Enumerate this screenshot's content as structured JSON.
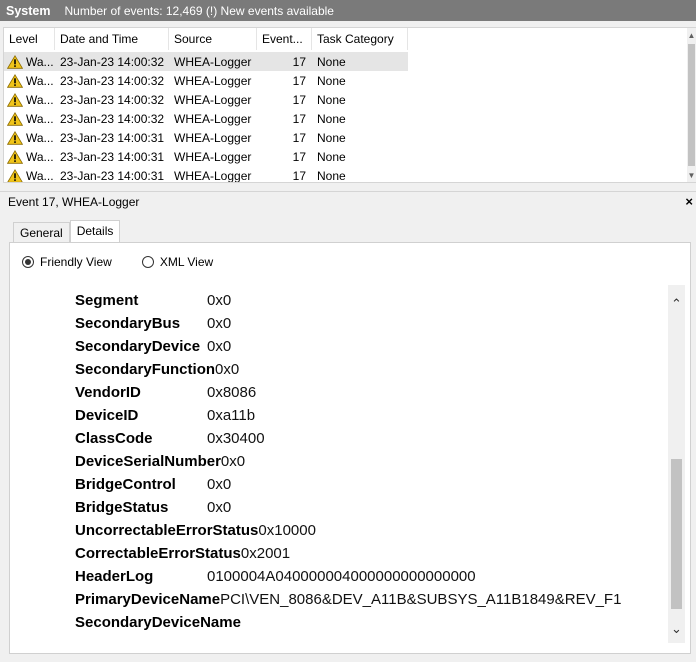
{
  "header": {
    "title": "System",
    "info": "Number of events: 12,469 (!) New events available"
  },
  "events": {
    "columns": [
      "Level",
      "Date and Time",
      "Source",
      "Event...",
      "Task Category"
    ],
    "rows": [
      {
        "level": "Wa...",
        "date": "23-Jan-23 14:00:32",
        "source": "WHEA-Logger",
        "id": "17",
        "task": "None"
      },
      {
        "level": "Wa...",
        "date": "23-Jan-23 14:00:32",
        "source": "WHEA-Logger",
        "id": "17",
        "task": "None"
      },
      {
        "level": "Wa...",
        "date": "23-Jan-23 14:00:32",
        "source": "WHEA-Logger",
        "id": "17",
        "task": "None"
      },
      {
        "level": "Wa...",
        "date": "23-Jan-23 14:00:32",
        "source": "WHEA-Logger",
        "id": "17",
        "task": "None"
      },
      {
        "level": "Wa...",
        "date": "23-Jan-23 14:00:31",
        "source": "WHEA-Logger",
        "id": "17",
        "task": "None"
      },
      {
        "level": "Wa...",
        "date": "23-Jan-23 14:00:31",
        "source": "WHEA-Logger",
        "id": "17",
        "task": "None"
      },
      {
        "level": "Wa...",
        "date": "23-Jan-23 14:00:31",
        "source": "WHEA-Logger",
        "id": "17",
        "task": "None"
      }
    ],
    "warning_color": "#f0c419",
    "selected_row": 0
  },
  "detail": {
    "title": "Event 17, WHEA-Logger",
    "close": "×",
    "tabs": [
      "General",
      "Details"
    ],
    "active_tab": "Details",
    "views": [
      {
        "label": "Friendly View",
        "selected": true
      },
      {
        "label": "XML View",
        "selected": false
      }
    ],
    "fields": [
      {
        "key": "Segment",
        "value": "0x0"
      },
      {
        "key": "SecondaryBus",
        "value": "0x0"
      },
      {
        "key": "SecondaryDevice",
        "value": "0x0"
      },
      {
        "key": "SecondaryFunction",
        "value": "0x0"
      },
      {
        "key": "VendorID",
        "value": "0x8086"
      },
      {
        "key": "DeviceID",
        "value": "0xa11b"
      },
      {
        "key": "ClassCode",
        "value": "0x30400"
      },
      {
        "key": "DeviceSerialNumber",
        "value": "0x0"
      },
      {
        "key": "BridgeControl",
        "value": "0x0"
      },
      {
        "key": "BridgeStatus",
        "value": "0x0"
      },
      {
        "key": "UncorrectableErrorStatus",
        "value": "0x10000"
      },
      {
        "key": "CorrectableErrorStatus",
        "value": "0x2001"
      },
      {
        "key": "HeaderLog",
        "value": "0100004A040000004000000000000000"
      },
      {
        "key": "PrimaryDeviceName",
        "value": "PCI\\VEN_8086&DEV_A11B&SUBSYS_A11B1849&REV_F1"
      },
      {
        "key": "SecondaryDeviceName",
        "value": ""
      }
    ]
  }
}
